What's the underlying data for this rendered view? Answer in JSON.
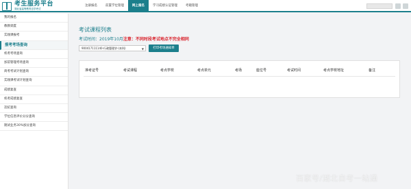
{
  "header": {
    "logo_title": "考生服务平台",
    "logo_subtitle": "湖北省高等教育自学考试",
    "nav": [
      {
        "label": "注册报名",
        "active": false
      },
      {
        "label": "前置学位管理",
        "active": false
      },
      {
        "label": "网上报名",
        "active": true
      },
      {
        "label": "学习成绩认证管理",
        "active": false
      },
      {
        "label": "考籍管理",
        "active": false
      }
    ]
  },
  "sidebar": {
    "items": [
      {
        "label": "我的报名",
        "section": false
      },
      {
        "label": "教教调度",
        "section": false
      },
      {
        "label": "实践课报考",
        "section": false
      },
      {
        "label": "报考考场查询",
        "section": true
      },
      {
        "label": "机考考场查询",
        "section": false
      },
      {
        "label": "加前管理考场查询",
        "section": false
      },
      {
        "label": "商考考试计划查询",
        "section": false
      },
      {
        "label": "实践课考试计划查询",
        "section": false
      },
      {
        "label": "成绩复查",
        "section": false
      },
      {
        "label": "机考成绩复查",
        "section": false
      },
      {
        "label": "违纪查询",
        "section": false
      },
      {
        "label": "学位信息评价分分查询",
        "section": false
      },
      {
        "label": "随试业务30%加分查询",
        "section": false
      }
    ]
  },
  "main": {
    "title": "考试课程列表",
    "exam_time_label": "考试时间：2019年10月",
    "exam_note": "注意：不同时段考试地点不完全相同",
    "select_value": "900417111140-行政管理学-(本科)",
    "print_button": "打印考场通知单",
    "columns": [
      "准考证号",
      "考试课程",
      "考点学校",
      "考点单元",
      "考场",
      "座位号",
      "考试时间",
      "考点学校地址",
      "备注"
    ]
  },
  "watermark": "百家号/湖北自考一站通",
  "colors": {
    "accent": "#1c7f8c",
    "warning": "#d9232d"
  }
}
